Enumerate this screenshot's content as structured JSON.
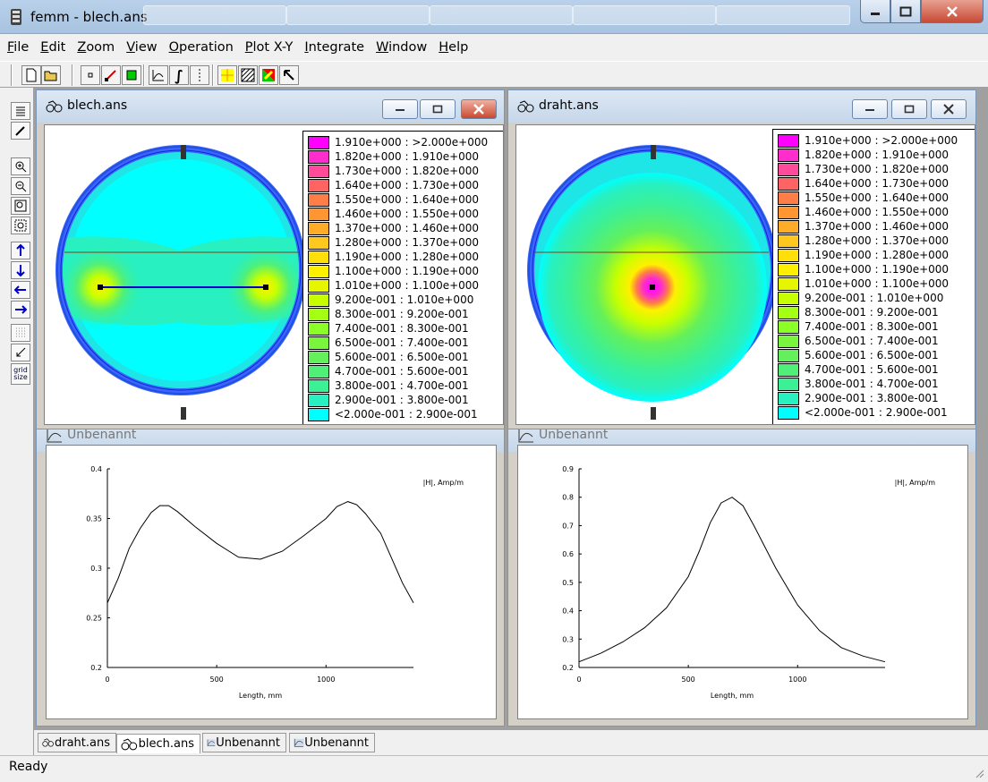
{
  "app": {
    "title": "femm - blech.ans"
  },
  "menu": [
    "File",
    "Edit",
    "Zoom",
    "View",
    "Operation",
    "Plot X-Y",
    "Integrate",
    "Window",
    "Help"
  ],
  "colors": {
    "accent": "#c6d7ea",
    "close": "#c94830"
  },
  "windows": {
    "blech": {
      "title": "blech.ans"
    },
    "draht": {
      "title": "draht.ans"
    },
    "plot1": {
      "title": "Unbenannt"
    },
    "plot2": {
      "title": "Unbenannt"
    }
  },
  "legend": {
    "rows": [
      {
        "label": "1.910e+000 : >2.000e+000",
        "color": "#ff00ff"
      },
      {
        "label": "1.820e+000 : 1.910e+000",
        "color": "#ff2dcb"
      },
      {
        "label": "1.730e+000 : 1.820e+000",
        "color": "#ff4b9a"
      },
      {
        "label": "1.640e+000 : 1.730e+000",
        "color": "#ff6464"
      },
      {
        "label": "1.550e+000 : 1.640e+000",
        "color": "#ff7d46"
      },
      {
        "label": "1.460e+000 : 1.550e+000",
        "color": "#ff9632"
      },
      {
        "label": "1.370e+000 : 1.460e+000",
        "color": "#ffad28"
      },
      {
        "label": "1.280e+000 : 1.370e+000",
        "color": "#ffc81e"
      },
      {
        "label": "1.190e+000 : 1.280e+000",
        "color": "#ffdf0a"
      },
      {
        "label": "1.100e+000 : 1.190e+000",
        "color": "#fff000"
      },
      {
        "label": "1.010e+000 : 1.100e+000",
        "color": "#e6f500"
      },
      {
        "label": "9.200e-001 : 1.010e+000",
        "color": "#c8ff00"
      },
      {
        "label": "8.300e-001 : 9.200e-001",
        "color": "#a5ff14"
      },
      {
        "label": "7.400e-001 : 8.300e-001",
        "color": "#8cff28"
      },
      {
        "label": "6.500e-001 : 7.400e-001",
        "color": "#78f53c"
      },
      {
        "label": "5.600e-001 : 6.500e-001",
        "color": "#64f05a"
      },
      {
        "label": "4.700e-001 : 5.600e-001",
        "color": "#50f078"
      },
      {
        "label": "3.800e-001 : 4.700e-001",
        "color": "#3cf096"
      },
      {
        "label": "2.900e-001 : 3.800e-001",
        "color": "#28f0c0"
      },
      {
        "label": "<2.000e-001 : 2.900e-001",
        "color": "#00ffff"
      }
    ]
  },
  "chart_data": [
    {
      "type": "line",
      "legend_label": "|H|, Amp/m",
      "xlabel": "Length, mm",
      "ylabel": "",
      "xlim": [
        0,
        1400
      ],
      "ylim": [
        0.2,
        0.4
      ],
      "xticks": [
        "0",
        "500",
        "1000"
      ],
      "yticks": [
        "0.2",
        "0.25",
        "0.3",
        "0.35",
        "0.4"
      ],
      "x": [
        0,
        50,
        100,
        150,
        200,
        240,
        280,
        320,
        400,
        500,
        600,
        700,
        800,
        900,
        1000,
        1050,
        1100,
        1140,
        1180,
        1250,
        1300,
        1350,
        1400
      ],
      "y": [
        0.265,
        0.29,
        0.32,
        0.34,
        0.356,
        0.363,
        0.363,
        0.357,
        0.342,
        0.325,
        0.311,
        0.309,
        0.317,
        0.333,
        0.35,
        0.362,
        0.367,
        0.364,
        0.355,
        0.335,
        0.31,
        0.285,
        0.265
      ]
    },
    {
      "type": "line",
      "legend_label": "|H|, Amp/m",
      "xlabel": "Length, mm",
      "ylabel": "",
      "xlim": [
        0,
        1400
      ],
      "ylim": [
        0.2,
        0.9
      ],
      "xticks": [
        "0",
        "500",
        "1000"
      ],
      "yticks": [
        "0.2",
        "0.3",
        "0.4",
        "0.5",
        "0.6",
        "0.7",
        "0.8",
        "0.9"
      ],
      "x": [
        0,
        100,
        200,
        300,
        400,
        500,
        550,
        600,
        650,
        700,
        750,
        800,
        900,
        1000,
        1100,
        1200,
        1300,
        1400
      ],
      "y": [
        0.22,
        0.25,
        0.29,
        0.34,
        0.41,
        0.52,
        0.61,
        0.71,
        0.78,
        0.8,
        0.77,
        0.7,
        0.55,
        0.42,
        0.33,
        0.27,
        0.24,
        0.22
      ]
    }
  ],
  "tabs": [
    {
      "label": "draht.ans",
      "active": false
    },
    {
      "label": "blech.ans",
      "active": true
    },
    {
      "label": "Unbenannt",
      "active": false
    },
    {
      "label": "Unbenannt",
      "active": false
    }
  ],
  "status": {
    "text": "Ready"
  },
  "lefttoolbar": {
    "grid_label": "grid\nsize"
  }
}
